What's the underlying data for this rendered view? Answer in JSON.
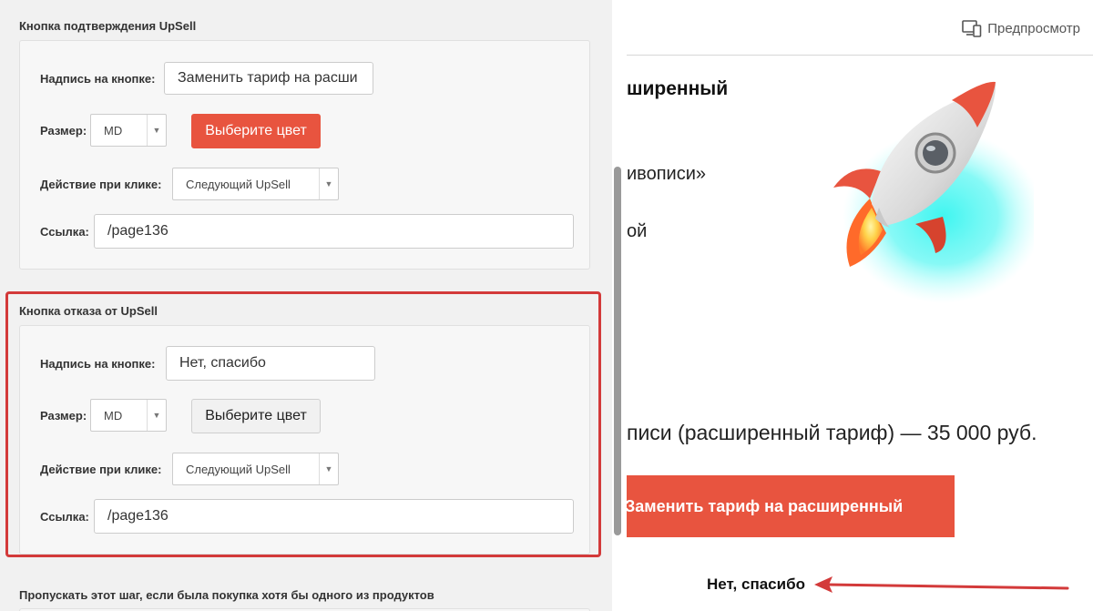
{
  "confirm_section": {
    "title": "Кнопка подтверждения UpSell",
    "button_text_label": "Надпись на кнопке:",
    "button_text_value": "Заменить тариф на расши",
    "size_label": "Размер:",
    "size_value": "MD",
    "color_button": "Выберите цвет",
    "color_value": "#e8543f",
    "action_label": "Действие при клике:",
    "action_value": "Следующий UpSell",
    "link_label": "Ссылка:",
    "link_value": "/page136"
  },
  "decline_section": {
    "title": "Кнопка отказа от UpSell",
    "button_text_label": "Надпись на кнопке:",
    "button_text_value": "Нет, спасибо",
    "size_label": "Размер:",
    "size_value": "MD",
    "color_button": "Выберите цвет",
    "action_label": "Действие при клике:",
    "action_value": "Следующий UpSell",
    "link_label": "Ссылка:",
    "link_value": "/page136"
  },
  "skip_section": {
    "title": "Пропускать этот шаг, если была покупка хотя бы одного из продуктов"
  },
  "preview": {
    "preview_button": "Предпросмотр",
    "heading_fragment": "ширенный",
    "line1_fragment": "ивописи»",
    "line2_fragment": "ой",
    "price_fragment": "писи (расширенный тариф) — 35 000 руб.",
    "upsell_button": "Заменить тариф на расширенный",
    "decline_link": "Нет, спасибо"
  },
  "colors": {
    "accent": "#e8543f",
    "highlight": "#d33a3a"
  }
}
